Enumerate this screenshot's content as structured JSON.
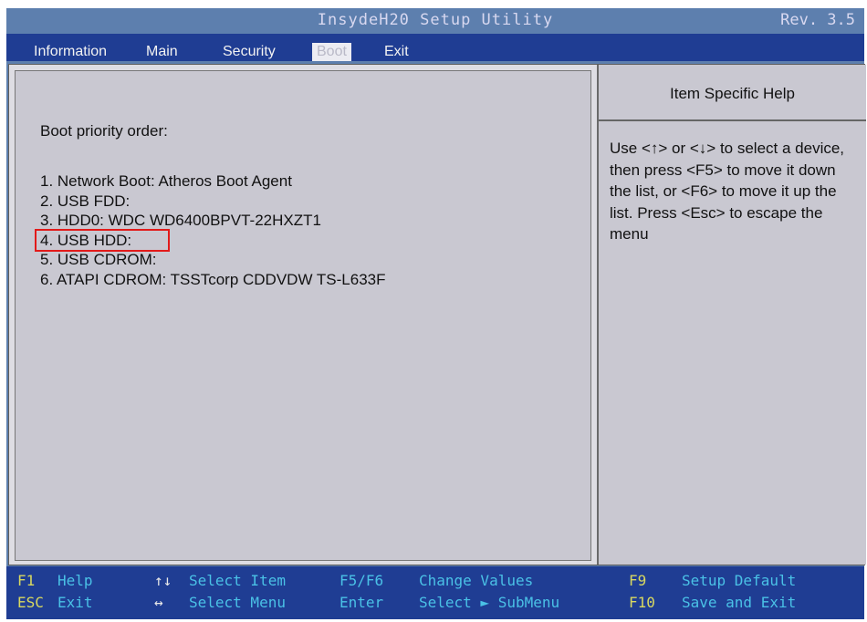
{
  "window": {
    "title": "InsydeH20 Setup Utility",
    "revision": "Rev.  3.5"
  },
  "menu": {
    "tabs": [
      {
        "label": "Information",
        "active": false
      },
      {
        "label": "Main",
        "active": false
      },
      {
        "label": "Security",
        "active": false
      },
      {
        "label": "Boot",
        "active": true
      },
      {
        "label": "Exit",
        "active": false
      }
    ]
  },
  "main": {
    "heading": "Boot priority order:",
    "boot_items": [
      "1. Network Boot: Atheros Boot Agent",
      "2. USB FDD:",
      "3. HDD0: WDC WD6400BPVT-22HXZT1",
      "4. USB HDD:",
      "5. USB CDROM:",
      "6. ATAPI CDROM: TSSTcorp CDDVDW TS-L633F"
    ],
    "highlighted_item": "4. USB HDD:"
  },
  "help": {
    "title": "Item Specific Help",
    "text": "Use <↑> or <↓> to select a device, then press <F5> to move it down the list, or <F6> to move it up the list. Press <Esc> to escape the menu"
  },
  "footer": {
    "row1": [
      {
        "key": "F1",
        "desc": "Help"
      },
      {
        "key": "↑↓",
        "desc": "Select  Item"
      },
      {
        "key": "F5/F6",
        "desc": "Change  Values"
      },
      {
        "key": "F9",
        "desc": "Setup  Default"
      }
    ],
    "row2": [
      {
        "key": "ESC",
        "desc": "Exit"
      },
      {
        "key": "↔",
        "desc": "Select  Menu"
      },
      {
        "key": "Enter",
        "desc": "Select ► SubMenu"
      },
      {
        "key": "F10",
        "desc": "Save  and  Exit"
      }
    ]
  },
  "colors": {
    "title_bar": "#5d7fae",
    "menu_bar": "#1f3d93",
    "pane_bg": "#c9c8d1",
    "highlight_outline": "#e21a1a",
    "key_color": "#d8d860",
    "footer_accent": "#4ac1e6"
  }
}
